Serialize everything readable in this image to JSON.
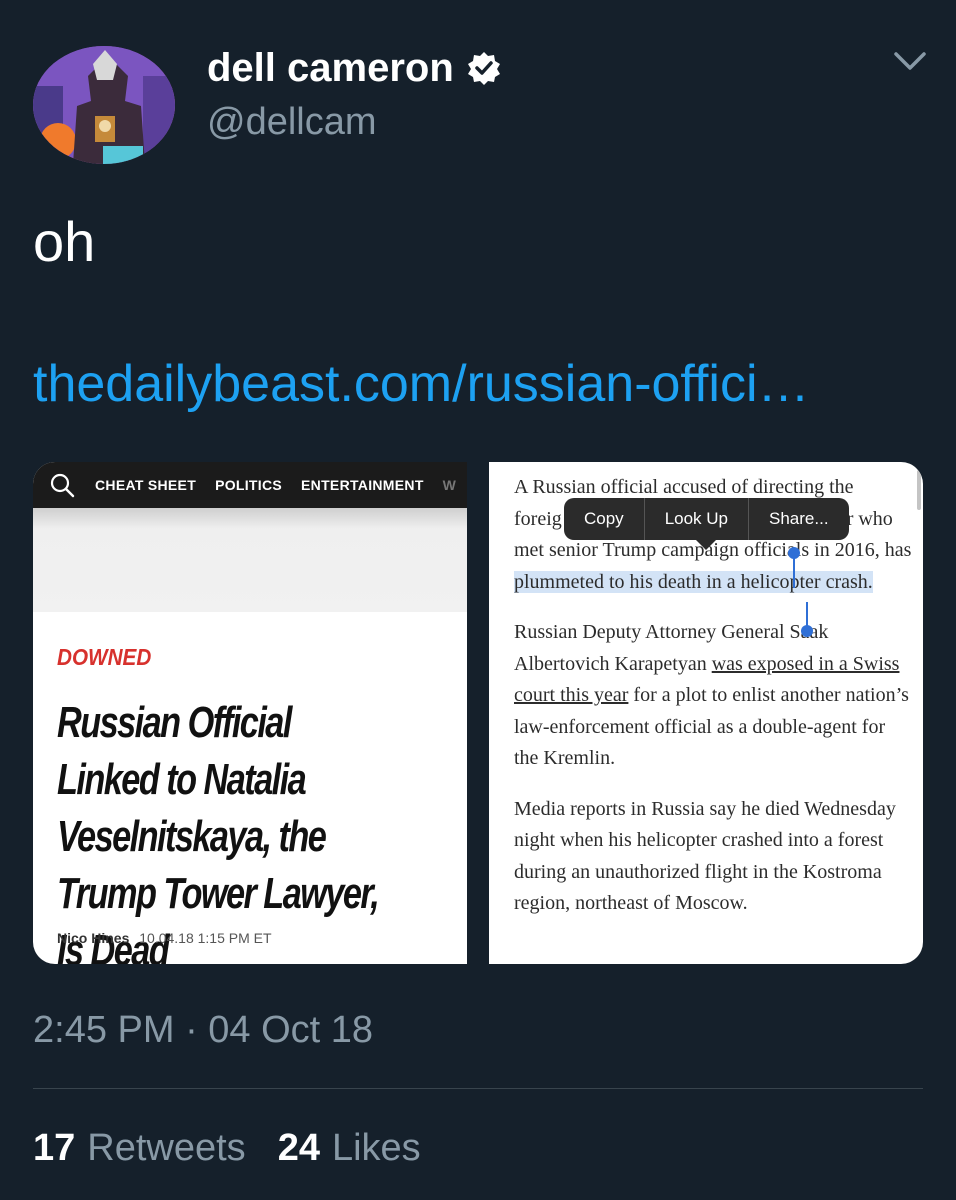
{
  "tweet": {
    "display_name": "dell cameron",
    "handle": "@dellcam",
    "verified": true,
    "text": "oh",
    "link": "thedailybeast.com/russian-offici…",
    "timestamp": "2:45 PM · 04 Oct 18",
    "stats": {
      "retweets_count": "17",
      "retweets_label": "Retweets",
      "likes_count": "24",
      "likes_label": "Likes"
    }
  },
  "media_left": {
    "nav": [
      "CHEAT SHEET",
      "POLITICS",
      "ENTERTAINMENT",
      "W"
    ],
    "kicker": "DOWNED",
    "headline": "Russian Official Linked to Natalia Veselnitskaya, the Trump Tower Lawyer, Is Dead",
    "author": "Nico Hines",
    "date": "10.04.18  1:15 PM ET"
  },
  "media_right": {
    "p1_pre": "A Russian official accused of directing the foreig",
    "p1_post": "kaya, the lawyer who met senior Trump campaign officials in 2016, has ",
    "p1_selected": "plummeted to his death in a helicopter crash.",
    "p2_pre": "Russian Deputy Attorney General Saak Albertovich Karapetyan ",
    "p2_link": "was exposed in a Swiss court this year",
    "p2_post": " for a plot to enlist another nation’s law-enforcement official as a double-agent for the Kremlin.",
    "p3": "Media reports in Russia say he died Wednesday night when his helicopter crashed into a forest during an unauthorized flight in the Kostroma region, northeast of Moscow.",
    "context_menu": [
      "Copy",
      "Look Up",
      "Share..."
    ]
  },
  "colors": {
    "background": "#15202b",
    "link": "#1da1f2",
    "secondary_text": "#8899a6",
    "kicker_red": "#d7312d",
    "selection": "#d3e3f6"
  }
}
